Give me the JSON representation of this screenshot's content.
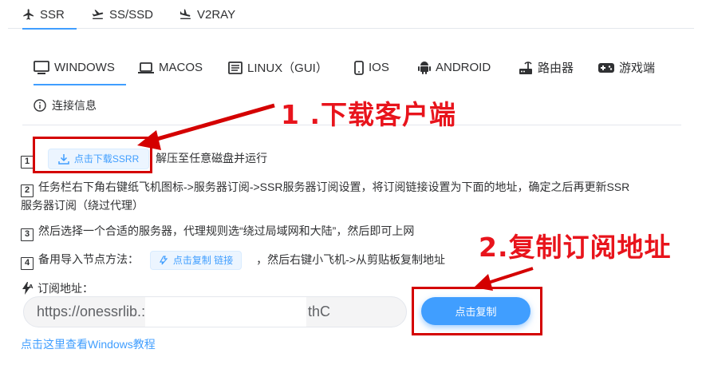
{
  "top_tabs": [
    {
      "label": "SSR",
      "icon": "airplane-icon",
      "active": true
    },
    {
      "label": "SS/SSD",
      "icon": "takeoff-icon",
      "active": false
    },
    {
      "label": "V2RAY",
      "icon": "landing-icon",
      "active": false
    }
  ],
  "os_tabs": [
    {
      "label": "WINDOWS",
      "icon": "monitor-icon",
      "active": true
    },
    {
      "label": "MACOS",
      "icon": "laptop-icon",
      "active": false
    },
    {
      "label": "LINUX（GUI）",
      "icon": "terminal-icon",
      "active": false
    },
    {
      "label": "IOS",
      "icon": "phone-icon",
      "active": false
    },
    {
      "label": "ANDROID",
      "icon": "android-icon",
      "active": false
    },
    {
      "label": "路由器",
      "icon": "router-icon",
      "active": false
    },
    {
      "label": "游戏端",
      "icon": "gamepad-icon",
      "active": false
    }
  ],
  "info_tab": {
    "label": "连接信息",
    "icon": "info-icon"
  },
  "steps": {
    "s1": {
      "num": "1",
      "button": "点击下载SSRR",
      "text": "解压至任意磁盘并运行"
    },
    "s2": {
      "num": "2",
      "line1": "任务栏右下角右键纸飞机图标->服务器订阅->SSR服务器订阅设置，将订阅链接设置为下面的地址，确定之后再更新SSR",
      "line2": "服务器订阅（绕过代理）"
    },
    "s3": {
      "num": "3",
      "text": "然后选择一个合适的服务器，代理规则选“绕过局域网和大陆”，然后即可上网"
    },
    "s4": {
      "num": "4",
      "prefix": "备用导入节点方法：",
      "button": "点击复制 链接",
      "suffix": "，然后右键小飞机->从剪贴板复制地址"
    }
  },
  "subscribe": {
    "label": "订阅地址：",
    "value_prefix": "https://onessrlib.:",
    "value_suffix": "thC",
    "copy_button": "点击复制"
  },
  "tutorial_link": "点击这里查看Windows教程",
  "annotations": {
    "a1": "1 .下载客户端",
    "a2": "2.复制订阅地址"
  },
  "colors": {
    "accent": "#409eff",
    "annotation": "#e8141c"
  }
}
